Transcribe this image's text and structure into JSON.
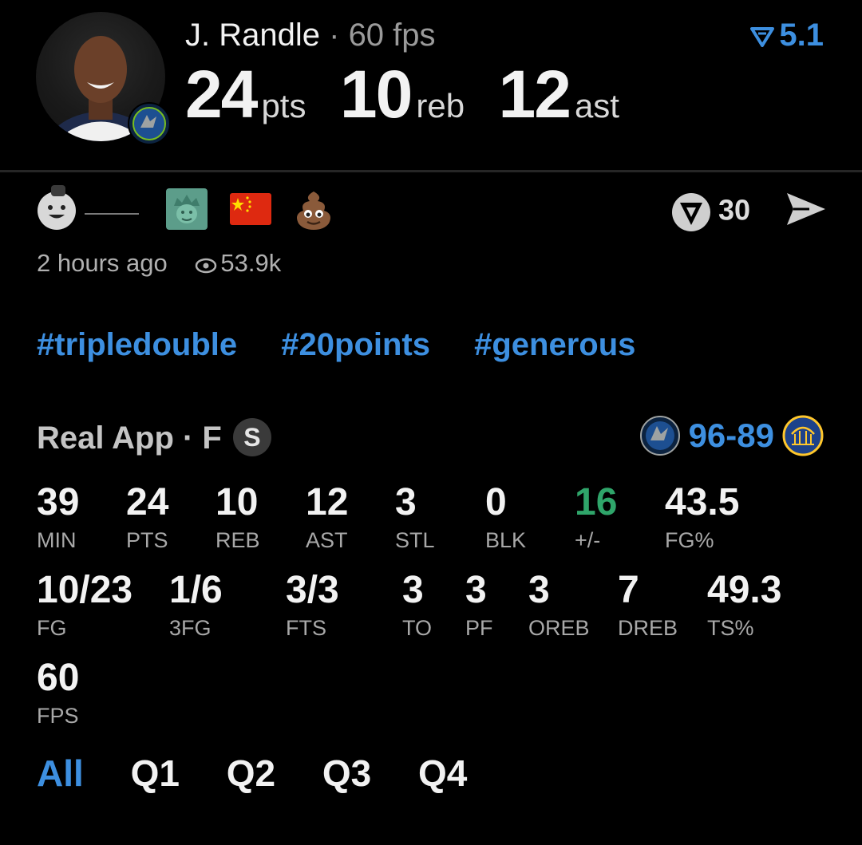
{
  "header": {
    "player_name": "J. Randle",
    "separator": "·",
    "fps_label": "60 fps",
    "rating_value": "5.1",
    "rating_icon": "rating-chevron-icon",
    "big_stats": [
      {
        "value": "24",
        "unit": "pts"
      },
      {
        "value": "10",
        "unit": "reb"
      },
      {
        "value": "12",
        "unit": "ast"
      }
    ]
  },
  "reactions": {
    "emojis": [
      "avatar-emoji",
      "statue-of-liberty",
      "china-flag",
      "pile-of-poo"
    ],
    "share_count": "30",
    "time_ago": "2 hours ago",
    "views": "53.9k"
  },
  "hashtags": [
    "#tripledouble",
    "#20points",
    "#generous"
  ],
  "game": {
    "source": "Real App · F",
    "status_badge": "S",
    "score_home": "96",
    "score_dash": "-",
    "score_away": "89",
    "home_logo": "timberwolves-logo",
    "away_logo": "warriors-logo"
  },
  "stats_row1": [
    {
      "value": "39",
      "label": "MIN"
    },
    {
      "value": "24",
      "label": "PTS"
    },
    {
      "value": "10",
      "label": "REB"
    },
    {
      "value": "12",
      "label": "AST"
    },
    {
      "value": "3",
      "label": "STL"
    },
    {
      "value": "0",
      "label": "BLK"
    },
    {
      "value": "16",
      "label": "+/-"
    },
    {
      "value": "43.5",
      "label": "FG%"
    }
  ],
  "stats_row2": [
    {
      "value": "10/23",
      "label": "FG"
    },
    {
      "value": "1/6",
      "label": "3FG"
    },
    {
      "value": "3/3",
      "label": "FTS"
    },
    {
      "value": "3",
      "label": "TO"
    },
    {
      "value": "3",
      "label": "PF"
    },
    {
      "value": "3",
      "label": "OREB"
    },
    {
      "value": "7",
      "label": "DREB"
    },
    {
      "value": "49.3",
      "label": "TS%"
    }
  ],
  "stats_row3": [
    {
      "value": "60",
      "label": "FPS"
    }
  ],
  "colors": {
    "accent": "#3d8fe0",
    "positive": "#2fa56a",
    "background": "#000000"
  },
  "tabs": [
    "All",
    "Q1",
    "Q2",
    "Q3",
    "Q4"
  ]
}
